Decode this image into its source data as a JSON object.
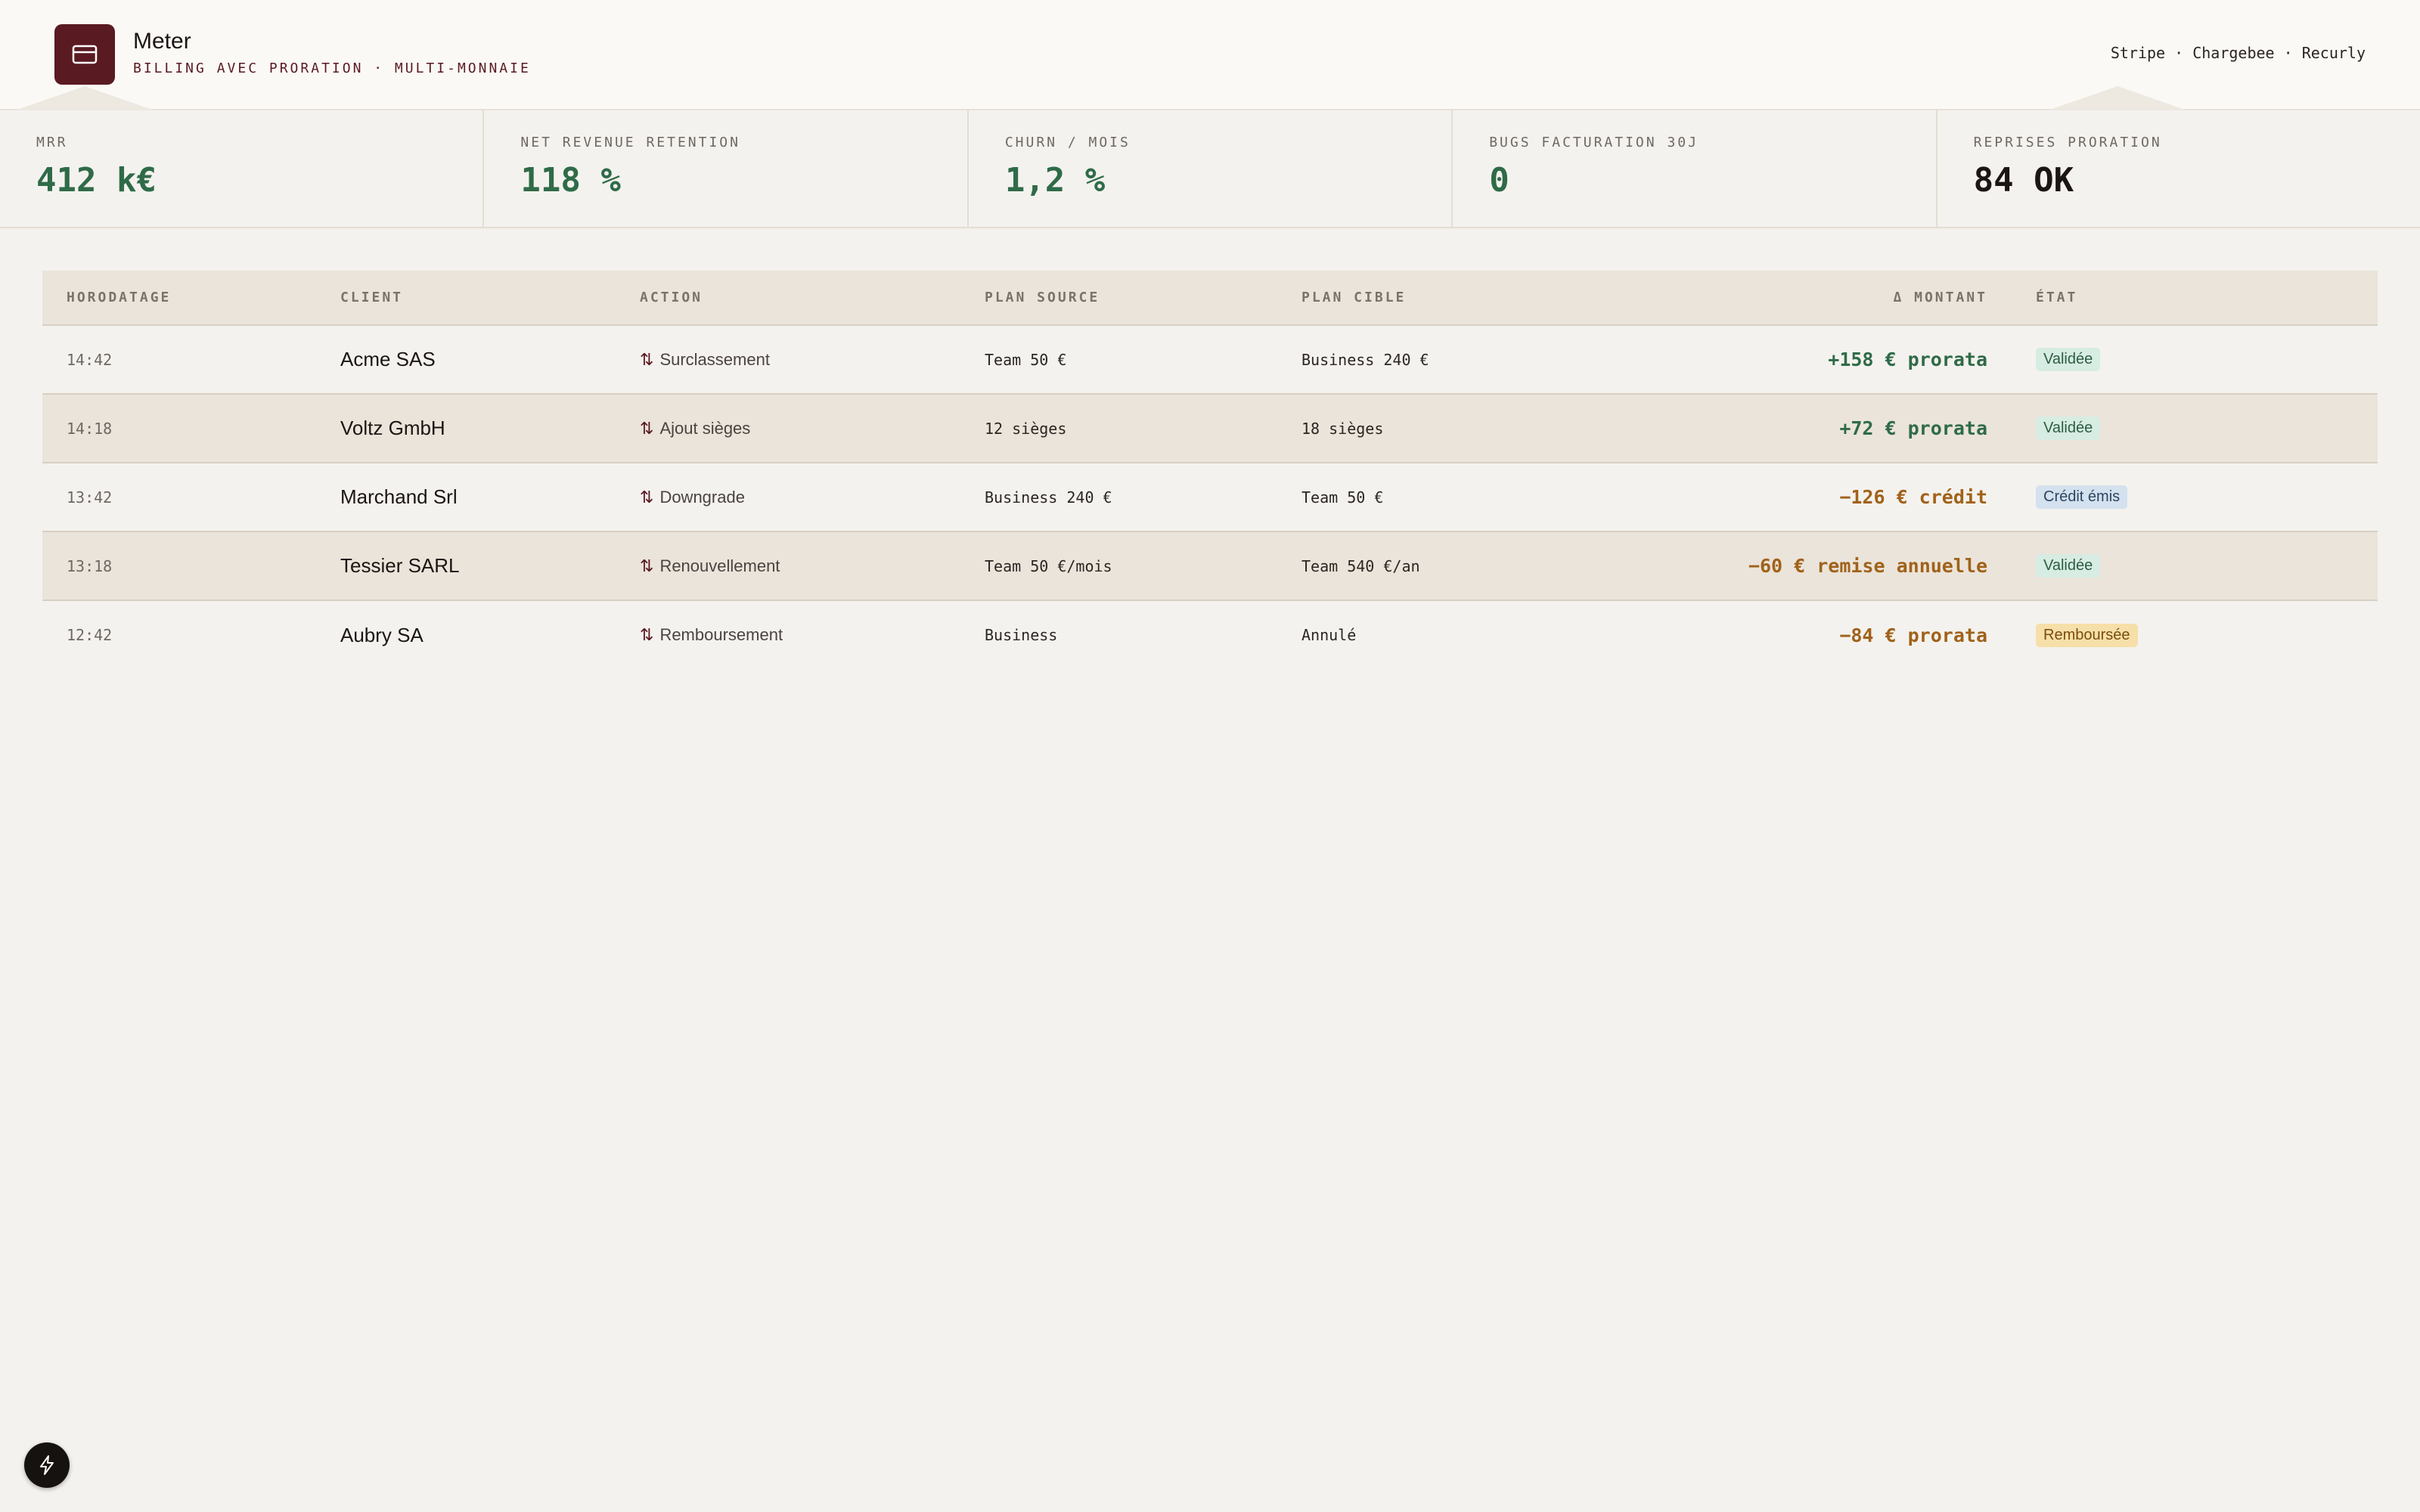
{
  "header": {
    "app_name": "Meter",
    "subtitle": "BILLING AVEC PRORATION · MULTI-MONNAIE",
    "providers": "Stripe · Chargebee · Recurly",
    "logo_icon": "credit-card-icon",
    "brand_color": "#5a1a22"
  },
  "kpis": [
    {
      "label": "MRR",
      "value": "412 k€",
      "color": "#2f6b48"
    },
    {
      "label": "NET REVENUE RETENTION",
      "value": "118 %",
      "color": "#2f6b48"
    },
    {
      "label": "CHURN / MOIS",
      "value": "1,2 %",
      "color": "#2f6b48"
    },
    {
      "label": "BUGS FACTURATION 30J",
      "value": "0",
      "color": "#2f6b48"
    },
    {
      "label": "REPRISES PRORATION",
      "value": "84 OK",
      "color": "#1b1514"
    }
  ],
  "table": {
    "columns": [
      "HORODATAGE",
      "CLIENT",
      "ACTION",
      "PLAN SOURCE",
      "PLAN CIBLE",
      "Δ MONTANT",
      "ÉTAT"
    ],
    "rows": [
      {
        "time": "14:42",
        "client": "Acme SAS",
        "action": "Surclassement",
        "source": "Team 50 €",
        "target": "Business 240 €",
        "amount": "+158 € prorata",
        "sign": "pos",
        "status": "Validée",
        "badge": "green"
      },
      {
        "time": "14:18",
        "client": "Voltz GmbH",
        "action": "Ajout sièges",
        "source": "12 sièges",
        "target": "18 sièges",
        "amount": "+72 € prorata",
        "sign": "pos",
        "status": "Validée",
        "badge": "green"
      },
      {
        "time": "13:42",
        "client": "Marchand Srl",
        "action": "Downgrade",
        "source": "Business 240 €",
        "target": "Team 50 €",
        "amount": "−126 € crédit",
        "sign": "neg",
        "status": "Crédit émis",
        "badge": "blue"
      },
      {
        "time": "13:18",
        "client": "Tessier SARL",
        "action": "Renouvellement",
        "source": "Team 50 €/mois",
        "target": "Team 540 €/an",
        "amount": "−60 € remise annuelle",
        "sign": "neg",
        "status": "Validée",
        "badge": "green"
      },
      {
        "time": "12:42",
        "client": "Aubry SA",
        "action": "Remboursement",
        "source": "Business",
        "target": "Annulé",
        "amount": "−84 € prorata",
        "sign": "neg",
        "status": "Remboursée",
        "badge": "yellow"
      }
    ],
    "action_icon": "swap-vertical-icon"
  },
  "fab": {
    "icon": "lightning-icon"
  }
}
